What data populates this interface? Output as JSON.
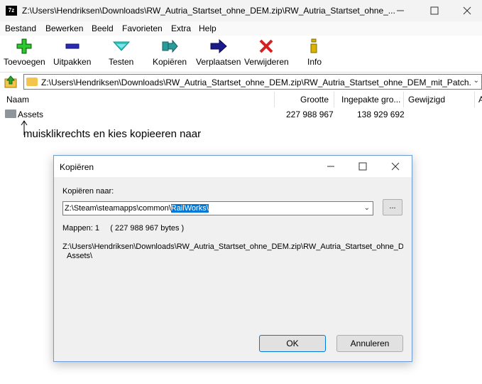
{
  "window": {
    "app_icon_text": "7z",
    "title": "Z:\\Users\\Hendriksen\\Downloads\\RW_Autria_Startset_ohne_DEM.zip\\RW_Autria_Startset_ohne_..."
  },
  "menu": [
    "Bestand",
    "Bewerken",
    "Beeld",
    "Favorieten",
    "Extra",
    "Help"
  ],
  "toolbar": {
    "add": "Toevoegen",
    "extract": "Uitpakken",
    "test": "Testen",
    "copy": "Kopiëren",
    "move": "Verplaatsen",
    "delete": "Verwijderen",
    "info": "Info"
  },
  "address": {
    "path": "Z:\\Users\\Hendriksen\\Downloads\\RW_Autria_Startset_ohne_DEM.zip\\RW_Autria_Startset_ohne_DEM_mit_Patch.rwp\\"
  },
  "list": {
    "columns": [
      "Naam",
      "Grootte",
      "Ingepakte gro...",
      "Gewijzigd",
      "A"
    ],
    "rows": [
      {
        "name": "Assets",
        "size": "227 988 967",
        "packed": "138 929 692",
        "modified": ""
      }
    ]
  },
  "annotation": "muisklikrechts en kies kopieeren naar",
  "dialog": {
    "title": "Kopiëren",
    "copy_to_label": "Kopiëren naar:",
    "destination_prefix": "Z:\\Steam\\steamapps\\common\\",
    "destination_selected": "RailWorks\\",
    "browse": "...",
    "folders_info": "Mappen: 1     ( 227 988 967 bytes )",
    "source_path": "Z:\\Users\\Hendriksen\\Downloads\\RW_Autria_Startset_ohne_DEM.zip\\RW_Autria_Startset_ohne_DE",
    "source_sub": "Assets\\",
    "ok": "OK",
    "cancel": "Annuleren"
  }
}
